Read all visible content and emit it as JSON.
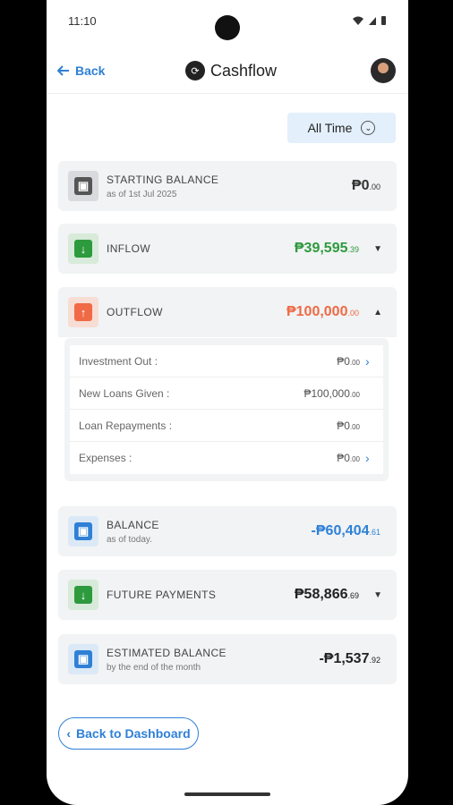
{
  "status": {
    "time": "11:10"
  },
  "header": {
    "back_label": "Back",
    "title": "Cashflow"
  },
  "filter": {
    "label": "All Time"
  },
  "cards": {
    "starting": {
      "title": "STARTING BALANCE",
      "sub": "as of 1st Jul 2025",
      "amount": "₱0",
      "cents": ".00",
      "color": "#333333"
    },
    "inflow": {
      "title": "INFLOW",
      "amount": "₱39,595",
      "cents": ".39",
      "color": "#2e9a3e"
    },
    "outflow": {
      "title": "OUTFLOW",
      "amount": "₱100,000",
      "cents": ".00",
      "color": "#ef6a45"
    },
    "balance": {
      "title": "BALANCE",
      "sub": "as of today.",
      "amount": "-₱60,404",
      "cents": ".61",
      "color": "#2f80d6"
    },
    "future": {
      "title": "FUTURE PAYMENTS",
      "amount": "₱58,866",
      "cents": ".69",
      "color": "#222222"
    },
    "estimated": {
      "title": "ESTIMATED BALANCE",
      "sub": "by the end of the month",
      "amount": "-₱1,537",
      "cents": ".92",
      "color": "#222222"
    }
  },
  "outflow_details": [
    {
      "label": "Investment Out :",
      "amount": "₱0",
      "cents": ".00"
    },
    {
      "label": "New Loans Given :",
      "amount": "₱100,000",
      "cents": ".00"
    },
    {
      "label": "Loan Repayments :",
      "amount": "₱0",
      "cents": ".00"
    },
    {
      "label": "Expenses :",
      "amount": "₱0",
      "cents": ".00"
    }
  ],
  "footer": {
    "back_dashboard_label": "Back to Dashboard"
  },
  "icons": {
    "back": "arrow-left-icon",
    "wallet": "wallet-icon",
    "inflow": "arrow-down-icon",
    "outflow": "arrow-up-icon",
    "caret_down": "caret-down-icon",
    "caret_up": "caret-up-icon",
    "chevron_right": "chevron-right-icon"
  }
}
